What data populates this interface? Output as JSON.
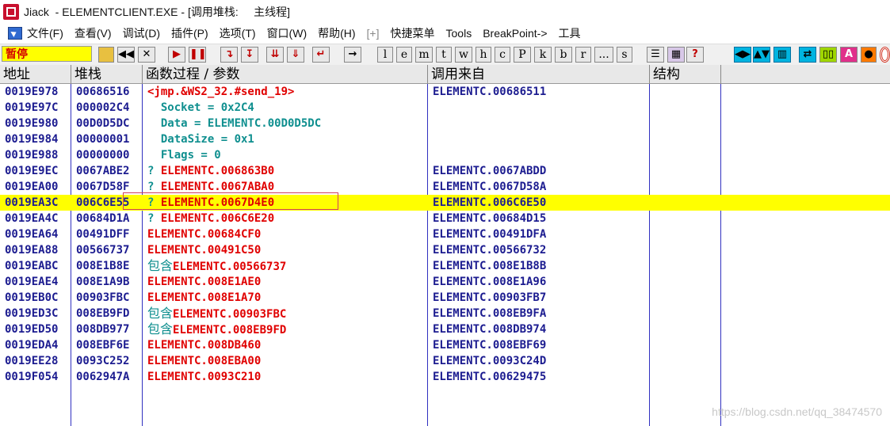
{
  "title_bar": {
    "app_name": "Jiack",
    "title": "  - ELEMENTCLIENT.EXE - [调用堆栈:     主线程]"
  },
  "menu": {
    "items": [
      "文件(F)",
      "查看(V)",
      "调试(D)",
      "插件(P)",
      "选项(T)",
      "窗口(W)",
      "帮助(H)",
      "[+]",
      "快捷菜单",
      "Tools",
      "BreakPoint->",
      "工具"
    ]
  },
  "toolbar": {
    "status": "暂停",
    "letter_buttons": [
      "l",
      "e",
      "m",
      "t",
      "w",
      "h",
      "c",
      "P",
      "k",
      "b",
      "r",
      "...",
      "s"
    ],
    "question_label": "?"
  },
  "columns": [
    "地址",
    "堆栈",
    "函数过程 / 参数",
    "调用来自",
    "结构"
  ],
  "rows": [
    {
      "addr": "0019E978",
      "stack": "00686516",
      "func": "<jmp.&WS2_32.#send_19>",
      "func_style": "red",
      "prefix": "",
      "caller": "ELEMENTC.00686511"
    },
    {
      "addr": "0019E97C",
      "stack": "000002C4",
      "func": "  Socket = 0x2C4",
      "func_style": "teal",
      "prefix": "",
      "caller": ""
    },
    {
      "addr": "0019E980",
      "stack": "00D0D5DC",
      "func": "  Data = ELEMENTC.00D0D5DC",
      "func_style": "teal",
      "prefix": "",
      "caller": ""
    },
    {
      "addr": "0019E984",
      "stack": "00000001",
      "func": "  DataSize = 0x1",
      "func_style": "teal",
      "prefix": "",
      "caller": ""
    },
    {
      "addr": "0019E988",
      "stack": "00000000",
      "func": "  Flags = 0",
      "func_style": "teal",
      "prefix": "",
      "caller": ""
    },
    {
      "addr": "0019E9EC",
      "stack": "0067ABE2",
      "func": "ELEMENTC.006863B0",
      "func_style": "red",
      "prefix": "? ",
      "caller": "ELEMENTC.0067ABDD"
    },
    {
      "addr": "0019EA00",
      "stack": "0067D58F",
      "func": "ELEMENTC.0067ABA0",
      "func_style": "red",
      "prefix": "? ",
      "caller": "ELEMENTC.0067D58A"
    },
    {
      "addr": "0019EA3C",
      "stack": "006C6E55",
      "func": "ELEMENTC.0067D4E0",
      "func_style": "red",
      "prefix": "? ",
      "caller": "ELEMENTC.006C6E50",
      "highlight": true
    },
    {
      "addr": "0019EA4C",
      "stack": "00684D1A",
      "func": "ELEMENTC.006C6E20",
      "func_style": "red",
      "prefix": "? ",
      "caller": "ELEMENTC.00684D15"
    },
    {
      "addr": "0019EA64",
      "stack": "00491DFF",
      "func": "ELEMENTC.00684CF0",
      "func_style": "red",
      "prefix": "",
      "caller": "ELEMENTC.00491DFA"
    },
    {
      "addr": "0019EA88",
      "stack": "00566737",
      "func": "ELEMENTC.00491C50",
      "func_style": "red",
      "prefix": "",
      "caller": "ELEMENTC.00566732"
    },
    {
      "addr": "0019EABC",
      "stack": "008E1B8E",
      "func": "ELEMENTC.00566737",
      "func_style": "red",
      "prefix": "包含",
      "caller": "ELEMENTC.008E1B8B"
    },
    {
      "addr": "0019EAE4",
      "stack": "008E1A9B",
      "func": "ELEMENTC.008E1AE0",
      "func_style": "red",
      "prefix": "",
      "caller": "ELEMENTC.008E1A96"
    },
    {
      "addr": "0019EB0C",
      "stack": "00903FBC",
      "func": "ELEMENTC.008E1A70",
      "func_style": "red",
      "prefix": "",
      "caller": "ELEMENTC.00903FB7"
    },
    {
      "addr": "0019ED3C",
      "stack": "008EB9FD",
      "func": "ELEMENTC.00903FBC",
      "func_style": "red",
      "prefix": "包含",
      "caller": "ELEMENTC.008EB9FA"
    },
    {
      "addr": "0019ED50",
      "stack": "008DB977",
      "func": "ELEMENTC.008EB9FD",
      "func_style": "red",
      "prefix": "包含",
      "caller": "ELEMENTC.008DB974"
    },
    {
      "addr": "0019EDA4",
      "stack": "008EBF6E",
      "func": "ELEMENTC.008DB460",
      "func_style": "red",
      "prefix": "",
      "caller": "ELEMENTC.008EBF69"
    },
    {
      "addr": "0019EE28",
      "stack": "0093C252",
      "func": "ELEMENTC.008EBA00",
      "func_style": "red",
      "prefix": "",
      "caller": "ELEMENTC.0093C24D"
    },
    {
      "addr": "0019F054",
      "stack": "0062947A",
      "func": "ELEMENTC.0093C210",
      "func_style": "red",
      "prefix": "",
      "caller": "ELEMENTC.00629475"
    }
  ],
  "watermark": "https://blog.csdn.net/qq_38474570"
}
